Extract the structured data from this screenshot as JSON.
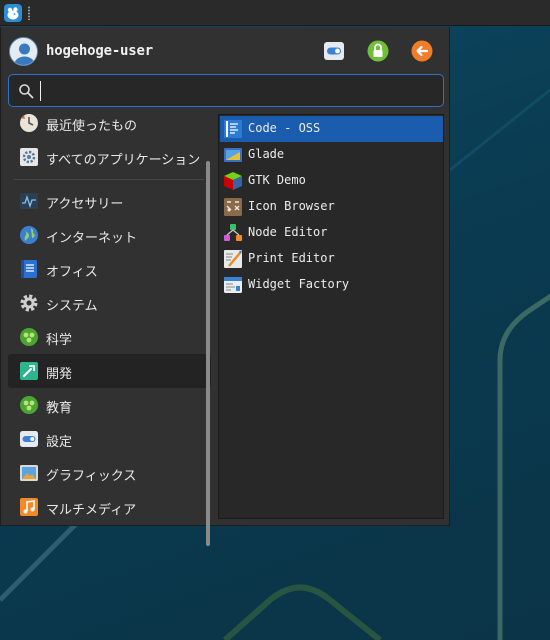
{
  "colors": {
    "accent": "#1a5cae",
    "search_border": "#2f73c4",
    "menu_bg": "#313131",
    "desktop": "#0b3b51"
  },
  "user": {
    "name": "hogehoge-user",
    "avatar_icon": "user-avatar-icon"
  },
  "header_buttons": [
    {
      "name": "settings",
      "icon": "toggle-icon"
    },
    {
      "name": "lock-screen",
      "icon": "lock-icon"
    },
    {
      "name": "log-out",
      "icon": "logout-arrow-icon"
    }
  ],
  "search": {
    "value": "",
    "placeholder": ""
  },
  "categories": [
    {
      "label": "最近使ったもの",
      "icon": "recent-icon"
    },
    {
      "label": "すべてのアプリケーション",
      "icon": "all-apps-icon"
    },
    {
      "label": "アクセサリー",
      "icon": "accessories-icon"
    },
    {
      "label": "インターネット",
      "icon": "globe-icon"
    },
    {
      "label": "オフィス",
      "icon": "office-icon"
    },
    {
      "label": "システム",
      "icon": "gear-icon"
    },
    {
      "label": "科学",
      "icon": "science-icon"
    },
    {
      "label": "開発",
      "icon": "development-icon",
      "active": true
    },
    {
      "label": "教育",
      "icon": "education-icon"
    },
    {
      "label": "設定",
      "icon": "settings-icon"
    },
    {
      "label": "グラフィックス",
      "icon": "graphics-icon"
    },
    {
      "label": "マルチメディア",
      "icon": "multimedia-icon"
    }
  ],
  "apps": [
    {
      "label": "Code - OSS",
      "icon": "code-oss-icon",
      "selected": true
    },
    {
      "label": "Glade",
      "icon": "glade-icon"
    },
    {
      "label": "GTK Demo",
      "icon": "gtk-cube-icon"
    },
    {
      "label": "Icon Browser",
      "icon": "icon-browser-icon"
    },
    {
      "label": "Node Editor",
      "icon": "node-editor-icon"
    },
    {
      "label": "Print Editor",
      "icon": "print-editor-icon"
    },
    {
      "label": "Widget Factory",
      "icon": "widget-factory-icon"
    }
  ]
}
